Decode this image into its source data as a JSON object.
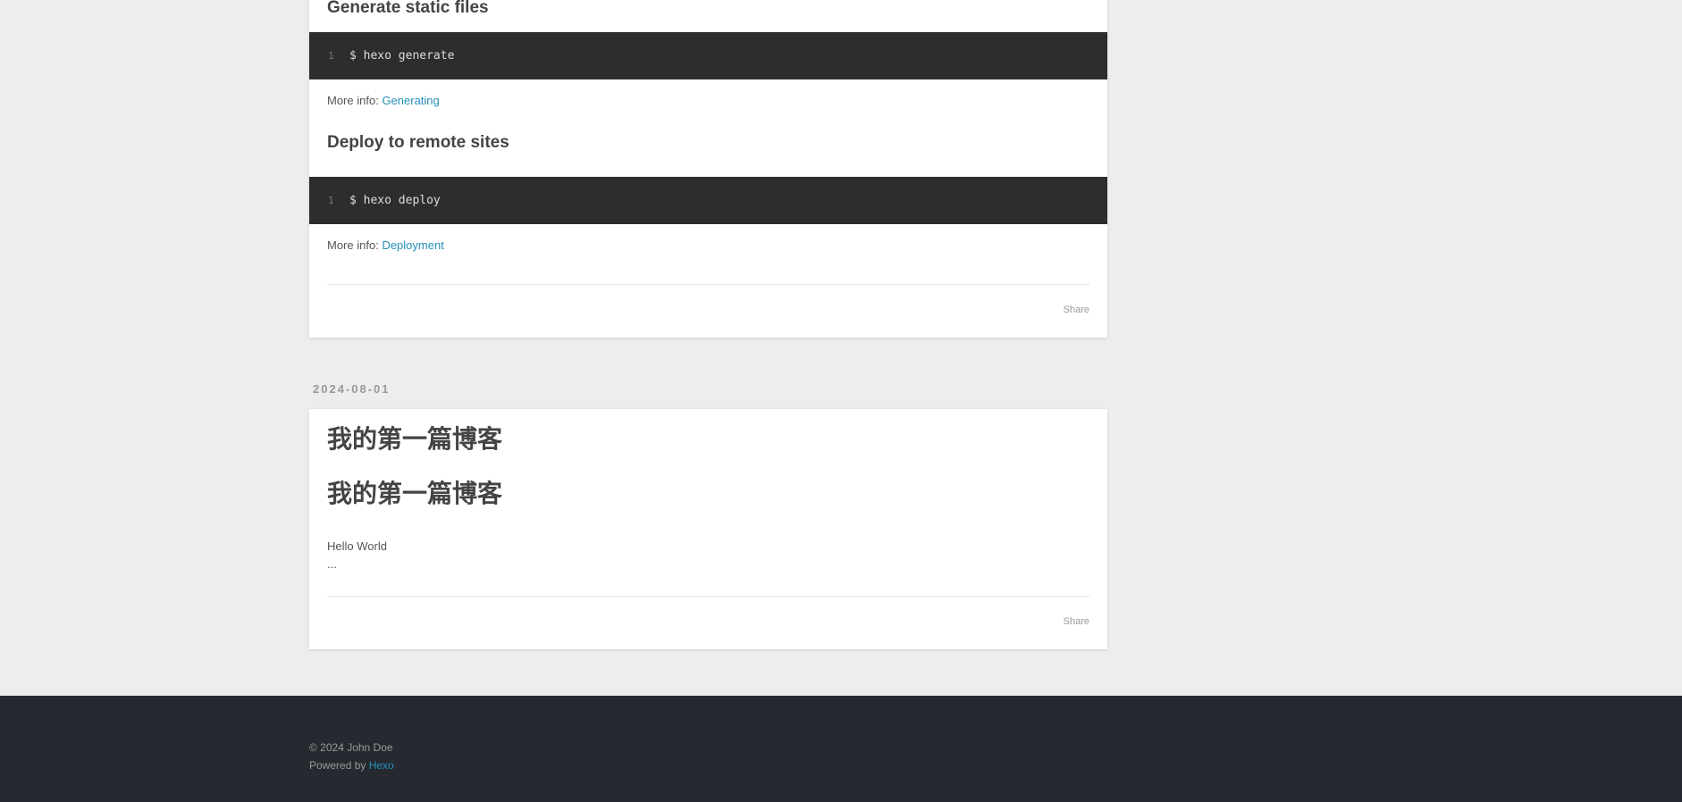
{
  "article_1": {
    "heading_generate": "Generate static files",
    "code_generate": {
      "line_number": "1",
      "code": "$ hexo generate"
    },
    "more_info_label_1": "More info:",
    "more_info_link_1": "Generating",
    "heading_deploy": "Deploy to remote sites",
    "code_deploy": {
      "line_number": "1",
      "code": "$ hexo deploy"
    },
    "more_info_label_2": "More info:",
    "more_info_link_2": "Deployment",
    "share_label": "Share"
  },
  "article_2": {
    "date": "2024-08-01",
    "title": "我的第一篇博客",
    "subtitle": "我的第一篇博客",
    "body": "Hello World",
    "ellipsis": "...",
    "share_label": "Share"
  },
  "footer": {
    "copyright": "© 2024 John Doe",
    "powered_by": "Powered by",
    "powered_link": "Hexo"
  },
  "colors": {
    "link": "#258fb8",
    "code_bg": "#2d2d2d",
    "footer_bg": "#262a30",
    "page_bg": "#ededed"
  }
}
